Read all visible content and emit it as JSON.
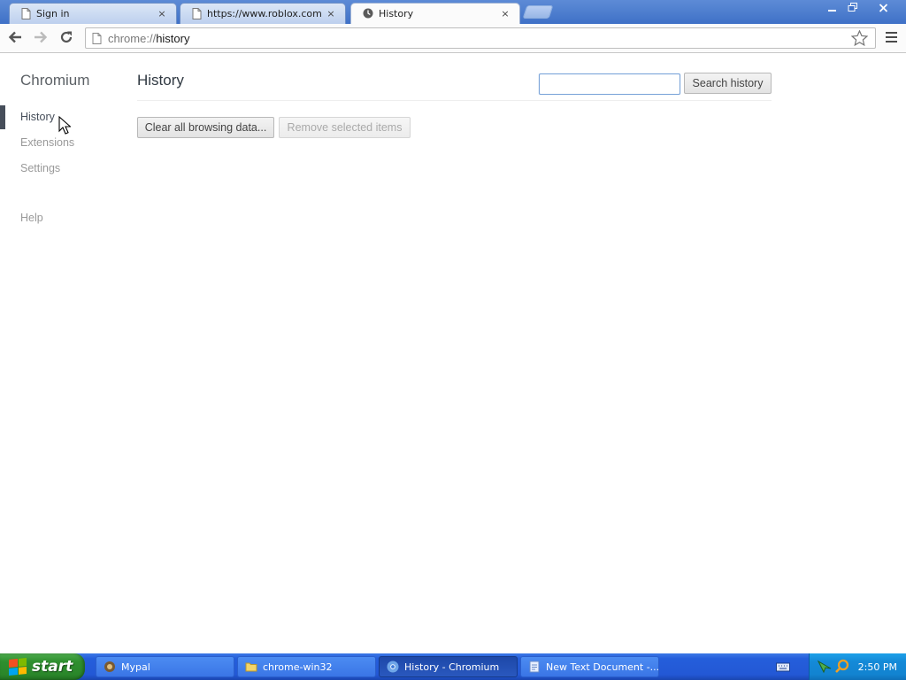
{
  "browser": {
    "tabs": [
      {
        "title": "Sign in",
        "favicon": "page-icon",
        "active": false
      },
      {
        "title": "https://www.roblox.com/ is r",
        "favicon": "page-icon",
        "active": false
      },
      {
        "title": "History",
        "favicon": "clock-icon",
        "active": true
      }
    ],
    "close_glyph": "×",
    "window_controls": {
      "minimize": "–",
      "maximize": "❐",
      "close": "X"
    },
    "omnibox": {
      "scheme": "chrome://",
      "host": "history"
    }
  },
  "sidebar": {
    "brand": "Chromium",
    "items": [
      {
        "label": "History",
        "selected": true
      },
      {
        "label": "Extensions",
        "selected": false
      },
      {
        "label": "Settings",
        "selected": false
      },
      {
        "label": "Help",
        "selected": false
      }
    ]
  },
  "main": {
    "title": "History",
    "search": {
      "value": "",
      "placeholder": "",
      "button": "Search history"
    },
    "clear_button": "Clear all browsing data...",
    "remove_button": "Remove selected items"
  },
  "taskbar": {
    "start_label": "start",
    "tasks": [
      {
        "label": "Mypal",
        "icon": "mypal-icon",
        "active": false
      },
      {
        "label": "chrome-win32",
        "icon": "folder-icon",
        "active": false
      },
      {
        "label": "History - Chromium",
        "icon": "chromium-icon",
        "active": true
      },
      {
        "label": "New Text Document -...",
        "icon": "notepad-icon",
        "active": false
      }
    ],
    "clock": "2:50 PM"
  },
  "colors": {
    "accent_nav": "#464e5a",
    "taskbar_blue": "#245edb",
    "start_green": "#2f8f2f",
    "tray_blue": "#148ad8"
  }
}
